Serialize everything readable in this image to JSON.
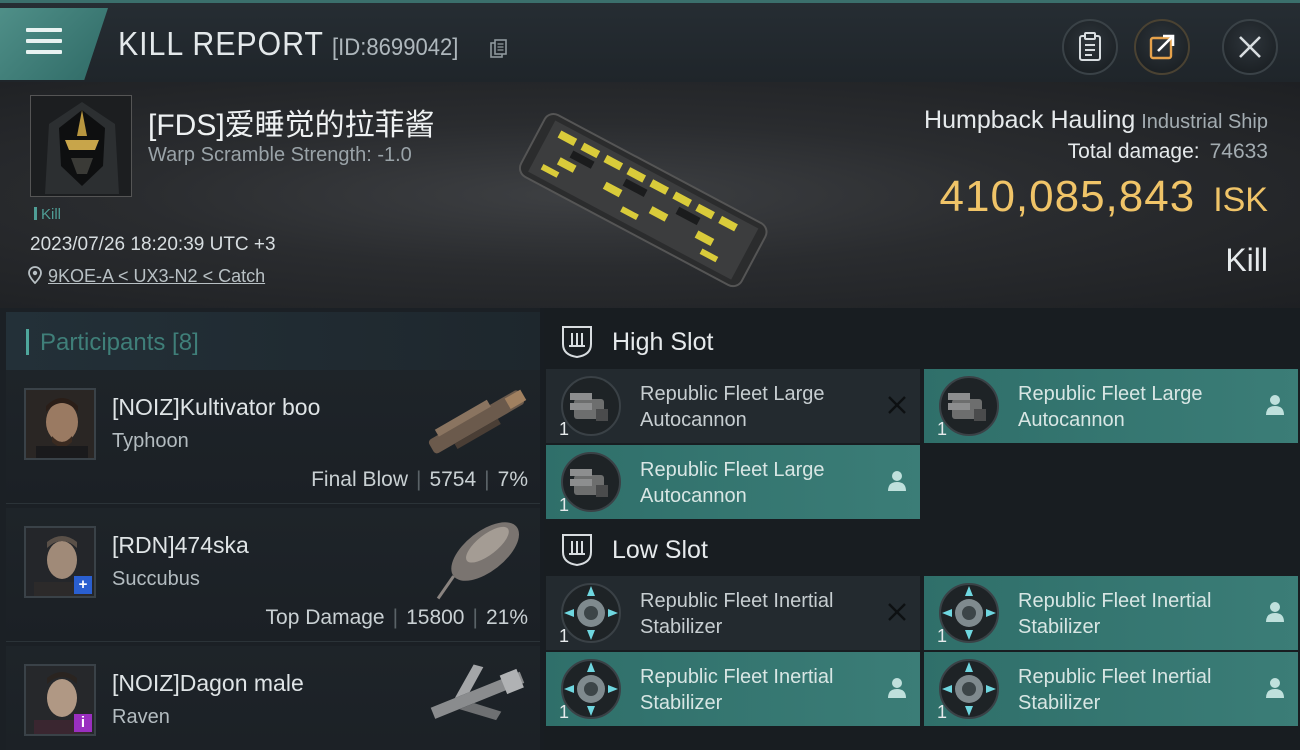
{
  "header": {
    "title": "KILL REPORT",
    "id_text": "[ID:8699042]"
  },
  "victim": {
    "name": "[FDS]爱睡觉的拉菲酱",
    "warp_scramble": "Warp Scramble Strength: -1.0",
    "tag": "Kill",
    "datetime": "2023/07/26 18:20:39 UTC +3",
    "location": "9KOE-A < UX3-N2 < Catch",
    "ship_name": "Humpback Hauling",
    "ship_class": "Industrial Ship",
    "total_damage_label": "Total damage:",
    "total_damage_value": "74633",
    "isk_amount": "410,085,843",
    "isk_currency": "ISK",
    "result": "Kill"
  },
  "participants": {
    "header_label": "Participants [8]",
    "rows": [
      {
        "name": "[NOIZ]Kultivator boo",
        "ship": "Typhoon",
        "tag": "Final Blow",
        "damage": "5754",
        "percent": "7%"
      },
      {
        "name": "[RDN]474ska",
        "ship": "Succubus",
        "tag": "Top Damage",
        "damage": "15800",
        "percent": "21%"
      },
      {
        "name": "[NOIZ]Dagon male",
        "ship": "Raven",
        "tag": "",
        "damage": "",
        "percent": ""
      }
    ]
  },
  "slots": {
    "high": {
      "label": "High Slot",
      "modules": [
        {
          "name": "Republic Fleet Large Autocannon",
          "qty": "1",
          "state": "destroyed"
        },
        {
          "name": "Republic Fleet Large Autocannon",
          "qty": "1",
          "state": "dropped"
        },
        {
          "name": "Republic Fleet Large Autocannon",
          "qty": "1",
          "state": "dropped"
        }
      ]
    },
    "low": {
      "label": "Low Slot",
      "modules": [
        {
          "name": "Republic Fleet Inertial Stabilizer",
          "qty": "1",
          "state": "destroyed"
        },
        {
          "name": "Republic Fleet Inertial Stabilizer",
          "qty": "1",
          "state": "dropped"
        },
        {
          "name": "Republic Fleet Inertial Stabilizer",
          "qty": "1",
          "state": "dropped"
        },
        {
          "name": "Republic Fleet Inertial Stabilizer",
          "qty": "1",
          "state": "dropped"
        }
      ]
    }
  },
  "colors": {
    "accent": "#4f8f88",
    "isk": "#f0c468",
    "dropped": "#3b7d77",
    "destroyed": "#232a2f"
  },
  "icons": {
    "menu": "hamburger-icon",
    "copy": "copy-icon",
    "report": "clipboard-icon",
    "share": "share-icon",
    "close": "close-icon",
    "location": "location-pin-icon",
    "destroyed": "x-icon",
    "dropped": "person-icon",
    "slot": "slot-shield-icon"
  }
}
